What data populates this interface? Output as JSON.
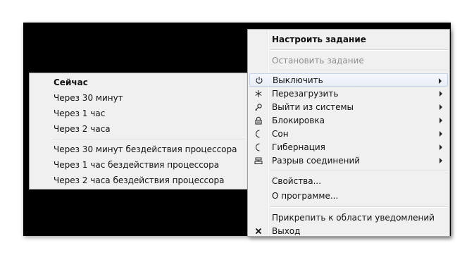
{
  "main_menu": {
    "items": [
      {
        "label": "Настроить задание"
      },
      {
        "label": "Остановить задание"
      },
      {
        "label": "Выключить"
      },
      {
        "label": "Перезагрузить"
      },
      {
        "label": "Выйти из системы"
      },
      {
        "label": "Блокировка"
      },
      {
        "label": "Сон"
      },
      {
        "label": "Гибернация"
      },
      {
        "label": "Разрыв соединений"
      },
      {
        "label": "Свойства..."
      },
      {
        "label": "О программе..."
      },
      {
        "label": "Прикрепить к области уведомлений"
      },
      {
        "label": "Выход"
      }
    ]
  },
  "sub_menu": {
    "items": [
      {
        "label": "Сейчас"
      },
      {
        "label": "Через 30 минут"
      },
      {
        "label": "Через 1 час"
      },
      {
        "label": "Через 2 часа"
      },
      {
        "label": "Через 30 минут бездействия процессора"
      },
      {
        "label": "Через 1 час бездействия процессора"
      },
      {
        "label": "Через 2 часа бездействия процессора"
      }
    ]
  },
  "icons": {
    "shutdown": "power-icon",
    "restart": "asterisk-icon",
    "logoff": "key-icon",
    "lock": "lock-icon",
    "sleep": "moon-icon",
    "hibernate": "moon-icon",
    "disconnect": "network-icon",
    "exit": "close-icon"
  }
}
